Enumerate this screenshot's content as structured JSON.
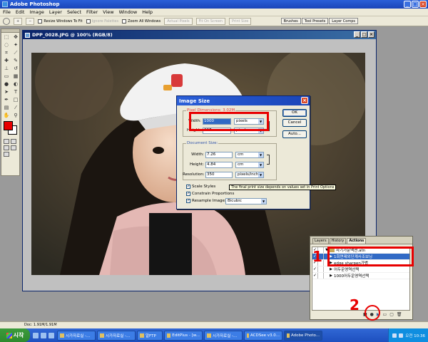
{
  "app": {
    "title": "Adobe Photoshop"
  },
  "menu": [
    "File",
    "Edit",
    "Image",
    "Layer",
    "Select",
    "Filter",
    "View",
    "Window",
    "Help"
  ],
  "options": {
    "resize_windows_label": "Resize Windows To Fit",
    "ignore_palettes_label": "Ignore Palettes",
    "zoom_all_label": "Zoom All Windows",
    "actual_pixels": "Actual Pixels",
    "fit_on_screen": "Fit On Screen",
    "print_size": "Print Size",
    "wells": [
      "Brushes",
      "Tool Presets",
      "Layer Comps"
    ]
  },
  "document": {
    "title": "DPP_0028.JPG @ 100% (RGB/8)"
  },
  "colors": {
    "foreground": "#e80000",
    "background": "#ffffff",
    "annotation": "#e80000"
  },
  "dialog": {
    "title": "Image Size",
    "pixel_group": "Pixel Dimensions: 3.02M",
    "width_label": "Width:",
    "width_value": "1000",
    "width_unit": "pixels",
    "height_label": "Height:",
    "height_value": "667",
    "height_unit": "pixels",
    "doc_group": "Document Size:",
    "doc_width_label": "Width:",
    "doc_width_value": "7.26",
    "doc_width_unit": "cm",
    "doc_height_label": "Height:",
    "doc_height_value": "4.84",
    "doc_height_unit": "cm",
    "resolution_label": "Resolution:",
    "resolution_value": "350",
    "resolution_unit": "pixels/inch",
    "scale_styles": "Scale Styles",
    "constrain": "Constrain Proportions",
    "resample": "Resample Image:",
    "resample_method": "Bicubic",
    "ok": "OK",
    "cancel": "Cancel",
    "auto": "Auto..."
  },
  "tooltip": "The final print size depends on values set in Print Options",
  "actions": {
    "tabs": [
      "Layers",
      "History",
      "Actions"
    ],
    "rows": [
      {
        "label": "사기가문액션.atn",
        "checked": true,
        "type": "set"
      },
      {
        "label": "1회면제외단계사조보닝",
        "checked": true,
        "type": "action",
        "selected": true
      },
      {
        "label": "edge sharpen가볍",
        "checked": true,
        "type": "action"
      },
      {
        "label": "어두운영역선택",
        "checked": true,
        "type": "action"
      },
      {
        "label": "1000어두운영역선택",
        "checked": true,
        "type": "action"
      }
    ]
  },
  "annotations": {
    "marker_1": "1",
    "marker_2": "2"
  },
  "status": {
    "text": "Doc: 1.91M/1.91M"
  },
  "taskbar": {
    "start": "시작",
    "tasks": [
      "시가자료실 -...",
      "시가자료실 -...",
      "알FTP",
      "EditPlus - [w...",
      "시가자료실 -...",
      "ACDSee v3.0...",
      "Adobe Photo..."
    ],
    "clock": "오전 10:36"
  }
}
